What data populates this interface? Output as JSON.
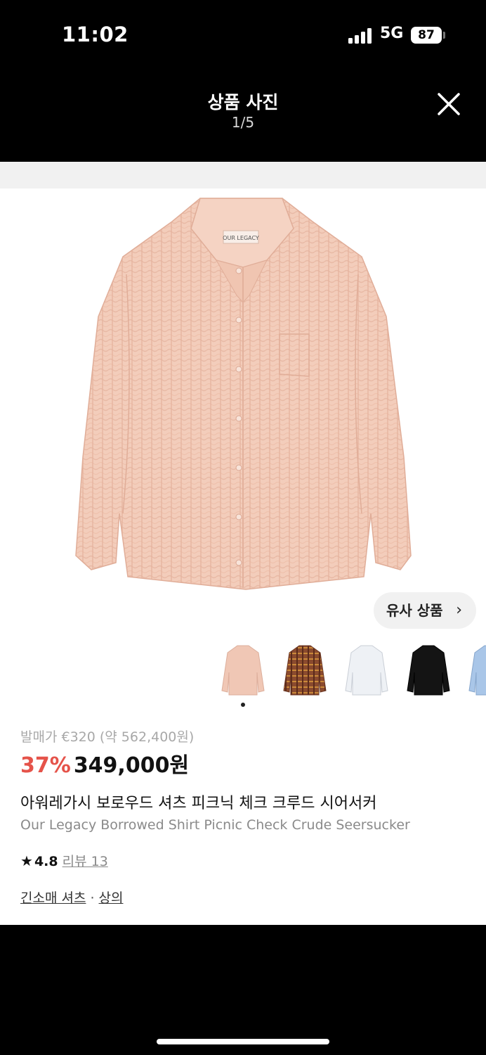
{
  "status_bar": {
    "time": "11:02",
    "network": "5G",
    "battery": "87"
  },
  "header": {
    "title": "상품 사진",
    "counter": "1/5",
    "close_icon": "close-icon"
  },
  "similar_button": {
    "label": "유사 상품",
    "chevron": "›"
  },
  "thumbnails": [
    {
      "name": "pink-seersucker-shirt",
      "color": "#f0c7b5"
    },
    {
      "name": "brown-check-shirt",
      "color": "#8a4a2e"
    },
    {
      "name": "white-shirt",
      "color": "#eef1f5"
    },
    {
      "name": "black-shirt",
      "color": "#141414"
    },
    {
      "name": "blue-shirt",
      "color": "#a9c6e8"
    }
  ],
  "product": {
    "original_price": "발매가 €320 (약 562,400원)",
    "discount": "37%",
    "price": "349,000원",
    "name_ko": "아워레가시 보로우드 셔츠 피크닉 체크 크루드 시어서커",
    "name_en": "Our Legacy Borrowed Shirt Picnic Check Crude Seersucker",
    "rating_star": "★",
    "rating": "4.8",
    "reviews": "리뷰 13",
    "category_1": "긴소매 셔츠",
    "category_sep": "·",
    "category_2": "상의",
    "label_text": "OUR LEGACY"
  },
  "colors": {
    "accent_red": "#e5534a",
    "shirt_pink": "#f3cdbb"
  }
}
